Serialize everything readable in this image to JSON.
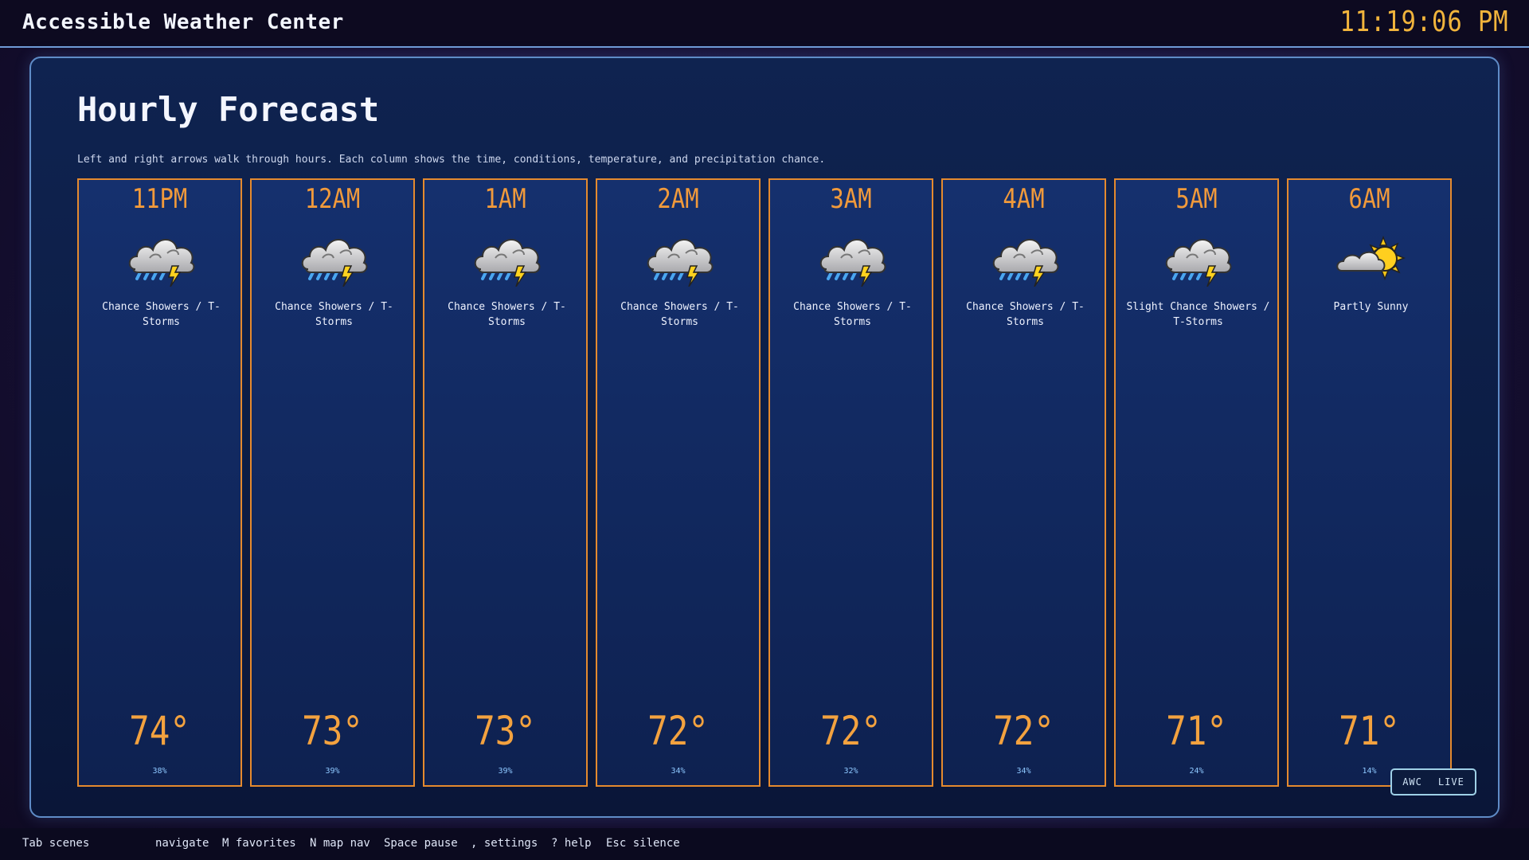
{
  "app": {
    "title": "Accessible Weather Center",
    "clock": "11:19:06 PM"
  },
  "page": {
    "title": "Hourly Forecast",
    "hint": "Left and right arrows walk through hours. Each column shows the time, conditions, temperature, and precipitation chance."
  },
  "hours": [
    {
      "time": "11PM",
      "icon": "thunderstorm-icon",
      "condition": "Chance Showers / T-Storms",
      "temp": "74°",
      "precip": "38%"
    },
    {
      "time": "12AM",
      "icon": "thunderstorm-icon",
      "condition": "Chance Showers / T-Storms",
      "temp": "73°",
      "precip": "39%"
    },
    {
      "time": "1AM",
      "icon": "thunderstorm-icon",
      "condition": "Chance Showers / T-Storms",
      "temp": "73°",
      "precip": "39%"
    },
    {
      "time": "2AM",
      "icon": "thunderstorm-icon",
      "condition": "Chance Showers / T-Storms",
      "temp": "72°",
      "precip": "34%"
    },
    {
      "time": "3AM",
      "icon": "thunderstorm-icon",
      "condition": "Chance Showers / T-Storms",
      "temp": "72°",
      "precip": "32%"
    },
    {
      "time": "4AM",
      "icon": "thunderstorm-icon",
      "condition": "Chance Showers / T-Storms",
      "temp": "72°",
      "precip": "34%"
    },
    {
      "time": "5AM",
      "icon": "thunderstorm-icon",
      "condition": "Slight Chance Showers / T-Storms",
      "temp": "71°",
      "precip": "24%"
    },
    {
      "time": "6AM",
      "icon": "partly-sunny-icon",
      "condition": "Partly Sunny",
      "temp": "71°",
      "precip": "14%"
    }
  ],
  "badge": {
    "left": "AWC",
    "right": "LIVE"
  },
  "footer": {
    "keys": [
      "Tab scenes",
      "navigate",
      "M favorites",
      "N map nav",
      "Space pause",
      ", settings",
      "? help",
      "Esc silence"
    ]
  },
  "colors": {
    "accent_orange": "#e58a2e",
    "clock_gold": "#f1b43c",
    "panel_border": "#5f8cc7",
    "precip_blue": "#8ec8ff"
  }
}
